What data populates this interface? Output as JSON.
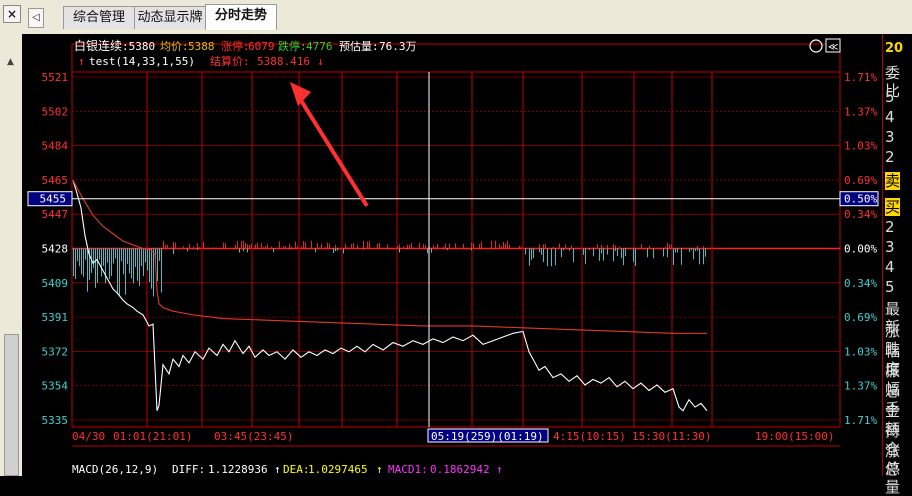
{
  "tabs": {
    "close_label": "×",
    "nav_label": "◁",
    "items": [
      "综合管理",
      "动态显示牌",
      "分时走势"
    ],
    "active": "分时走势"
  },
  "header": {
    "name": "白银连续",
    "code": ":5380",
    "avg_label": "均价:",
    "avg_value": "5388",
    "limit_up_label": "涨停:",
    "limit_up_value": "6079",
    "limit_down_label": "跌停:",
    "limit_down_value": "4776",
    "est_vol_label": "预估量:",
    "est_vol_value": "76.3万",
    "indicator_prefix": "↑",
    "indicator": "test(14,33,1,55)",
    "settle_label": "结算价:",
    "settle_value": "5388.416",
    "settle_arrow": "↓"
  },
  "controls": {
    "gear_glyph": "⚙",
    "prev_glyph": "≪"
  },
  "chart_data": {
    "type": "line",
    "title": "",
    "y_left_ticks": [
      "5521",
      "5502",
      "5484",
      "5465",
      "5447",
      "5428",
      "5409",
      "5391",
      "5372",
      "5354",
      "5335"
    ],
    "y_right_ticks": [
      "1.71%",
      "1.37%",
      "1.03%",
      "0.69%",
      "0.34%",
      "0.00%",
      "0.34%",
      "0.69%",
      "1.03%",
      "1.37%",
      "1.71%"
    ],
    "y_range": [
      5335,
      5521
    ],
    "prev_close": 5428,
    "crosshair": {
      "price": "5455",
      "pct": "0.50%",
      "time": "05:19(259)(01:19)"
    },
    "x_labels": [
      "04/30",
      "01:01(21:01)",
      "03:45(23:45)",
      "4:15(10:15)",
      "15:30(11:30)",
      "19:00(15:00)"
    ],
    "series": [
      {
        "role": "price",
        "color": "#ffffff",
        "x": [
          0,
          4,
          8,
          12,
          16,
          20,
          24,
          30,
          34,
          40,
          44,
          50,
          54,
          60,
          64,
          70,
          76,
          80,
          84,
          86,
          90,
          96,
          100,
          106,
          110,
          116,
          122,
          130,
          136,
          144,
          150,
          156,
          162,
          170,
          176,
          182,
          190,
          196,
          204,
          212,
          220,
          228,
          236,
          244,
          252,
          260,
          268,
          276,
          284,
          292,
          300,
          310,
          320,
          330,
          340,
          350,
          360,
          370,
          380,
          390,
          400,
          410,
          420,
          430,
          440,
          450,
          456,
          460,
          466,
          472,
          480,
          488,
          496,
          504,
          512,
          520,
          528,
          536,
          544,
          552,
          560,
          568,
          576,
          584,
          592,
          600,
          606,
          610,
          616,
          622,
          628,
          634
        ],
        "y": [
          5465,
          5458,
          5450,
          5435,
          5425,
          5420,
          5422,
          5416,
          5412,
          5406,
          5404,
          5400,
          5398,
          5396,
          5394,
          5392,
          5386,
          5387,
          5340,
          5343,
          5365,
          5360,
          5368,
          5364,
          5370,
          5366,
          5372,
          5368,
          5374,
          5370,
          5376,
          5372,
          5378,
          5371,
          5375,
          5369,
          5373,
          5370,
          5372,
          5368,
          5373,
          5369,
          5372,
          5370,
          5373,
          5371,
          5374,
          5372,
          5375,
          5372,
          5376,
          5373,
          5377,
          5375,
          5378,
          5376,
          5379,
          5377,
          5380,
          5378,
          5381,
          5376,
          5378,
          5380,
          5382,
          5383,
          5372,
          5368,
          5362,
          5364,
          5358,
          5360,
          5356,
          5359,
          5354,
          5357,
          5355,
          5358,
          5353,
          5356,
          5352,
          5355,
          5351,
          5354,
          5350,
          5352,
          5342,
          5340,
          5346,
          5342,
          5344,
          5340
        ]
      },
      {
        "role": "avg",
        "color": "#e03a2a",
        "x": [
          0,
          10,
          20,
          30,
          40,
          50,
          60,
          70,
          78,
          82,
          84,
          86,
          90,
          100,
          120,
          150,
          200,
          250,
          300,
          350,
          400,
          450,
          500,
          550,
          600,
          634
        ],
        "y": [
          5465,
          5455,
          5446,
          5440,
          5436,
          5432,
          5430,
          5428,
          5427,
          5425,
          5405,
          5398,
          5396,
          5394,
          5392,
          5390,
          5389,
          5388,
          5387,
          5386,
          5386,
          5385,
          5384,
          5383,
          5382,
          5382
        ]
      }
    ],
    "volume_bars": {
      "up_color": "#e8261a",
      "down_color": "#3fc1c9"
    }
  },
  "macd": {
    "label": "MACD(26,12,9)",
    "diff_label": "DIFF:",
    "diff_value": "1.1228936",
    "diff_arrow": "↑",
    "dea_label": "DEA:",
    "dea_value": "1.0297465",
    "dea_arrow": "↑",
    "macd1_label": "MACD1:",
    "macd1_value": "0.1862942",
    "macd1_arrow": "↑"
  },
  "right_panel": {
    "year_frag": "20",
    "items": [
      "委比",
      "5",
      "4",
      "3",
      "2",
      "卖",
      "买",
      "2",
      "3",
      "4",
      "5",
      "最新",
      "涨跌",
      "幅度",
      "振幅",
      "总手",
      "金额",
      "持仓",
      "涨停",
      "总量"
    ]
  },
  "colors": {
    "grid_red": "#c00000",
    "axis_red": "#ff3030",
    "header_gold": "#e0c000",
    "limit_up_red": "#ff3030",
    "limit_down_green": "#30d030",
    "macd_yellow": "#ffff00",
    "macd_magenta": "#ff30ff",
    "crosshair_bg": "#000080"
  }
}
